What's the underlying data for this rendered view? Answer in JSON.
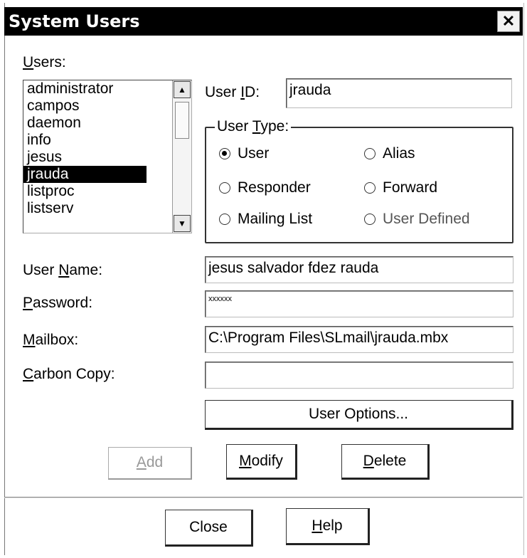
{
  "window": {
    "title": "System Users",
    "close_glyph": "✕"
  },
  "users": {
    "label_u": "U",
    "label_rest": "sers:",
    "items": [
      "administrator",
      "campos",
      "daemon",
      "info",
      "jesus",
      "jrauda",
      "listproc",
      "listserv"
    ],
    "selected": "jrauda"
  },
  "user_id": {
    "label_a": "User ",
    "label_u": "I",
    "label_b": "D:",
    "value": "jrauda"
  },
  "user_type": {
    "legend_a": "User ",
    "legend_u": "T",
    "legend_b": "ype:",
    "options": {
      "user": "User",
      "alias": "Alias",
      "responder": "Responder",
      "forward": "Forward",
      "mailing_list": "Mailing List",
      "user_defined": "User Defined"
    },
    "selected": "User"
  },
  "fields": {
    "user_name": {
      "label_a": "User ",
      "label_u": "N",
      "label_b": "ame:",
      "value": "jesus salvador fdez rauda"
    },
    "password": {
      "label_u": "P",
      "label_b": "assword:",
      "value": "xxxxxx"
    },
    "mailbox": {
      "label_u": "M",
      "label_b": "ailbox:",
      "value": "C:\\Program Files\\SLmail\\jrauda.mbx"
    },
    "carbon_copy": {
      "label_u": "C",
      "label_b": "arbon Copy:",
      "value": ""
    }
  },
  "buttons": {
    "user_options": "User Options...",
    "add_u": "A",
    "add_b": "dd",
    "modify_u": "M",
    "modify_b": "odify",
    "delete_u": "D",
    "delete_b": "elete",
    "close": "Close",
    "help_u": "H",
    "help_b": "elp"
  }
}
